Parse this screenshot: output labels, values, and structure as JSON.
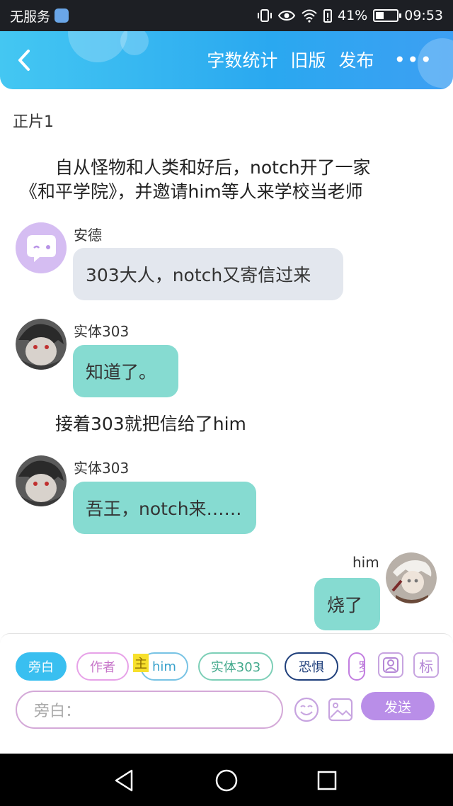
{
  "status": {
    "carrier": "无服务",
    "battery": "41%",
    "battery_level": 0.41,
    "time": "09:53"
  },
  "header": {
    "word_count": "字数统计",
    "old_version": "旧版",
    "publish": "发布",
    "more": "•••"
  },
  "content": {
    "episode": "正片1",
    "narration1_line1": "自从怪物和人类和好后，notch开了一家",
    "narration1_line2": "《和平学院》，并邀请him等人来学校当老师",
    "messages": [
      {
        "name": "安德",
        "text": "303大人，notch又寄信过来"
      },
      {
        "name": "实体303",
        "text": "知道了。"
      },
      {
        "name": "实体303",
        "text": "吾王，notch来……"
      },
      {
        "name": "him",
        "text": "烧了"
      }
    ],
    "narration2": "接着303就把信给了him"
  },
  "input_bar": {
    "chips": [
      "旁白",
      "作者",
      "him",
      "实体303",
      "恐惧",
      "罗"
    ],
    "main_tag": "主",
    "role_btn": "",
    "tag_btn": "标",
    "placeholder": "旁白：",
    "send": "发送"
  }
}
